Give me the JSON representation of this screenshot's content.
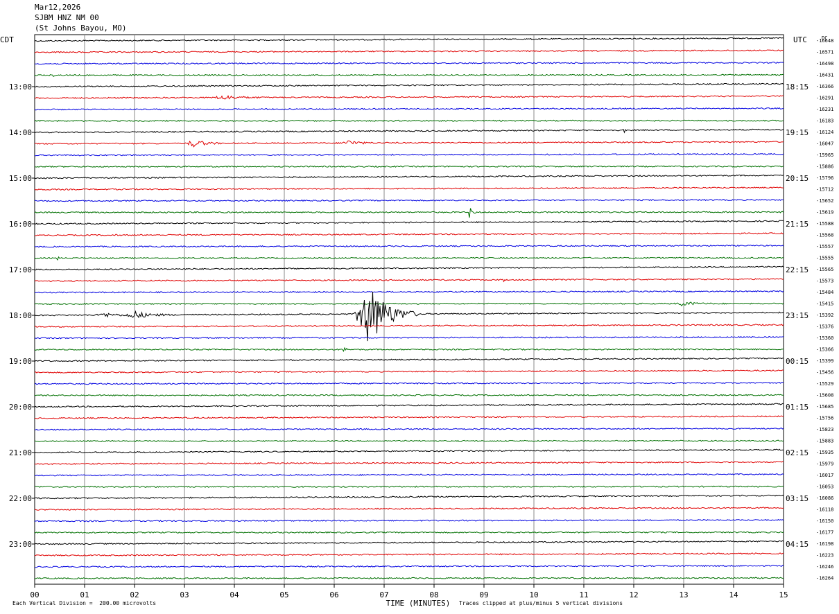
{
  "header": {
    "date": "Mar12,2026",
    "station": "SJBM HNZ NM 00",
    "location": "(St Johns Bayou, MO)"
  },
  "left_tz": "CDT",
  "right_tz": "UTC",
  "dc_label": "DC",
  "footer": {
    "scale_note": "Each Vertical Division =  200.00 microvolts",
    "clip_note": "Traces clipped at plus/minus 5 vertical divisions"
  },
  "colors": {
    "trace_cycle": [
      "#000000",
      "#e00000",
      "#0000e0",
      "#007000"
    ],
    "grid": "#888888"
  },
  "chart_data": {
    "type": "line",
    "title": "SJBM HNZ NM 00",
    "xlabel": "TIME (MINUTES)",
    "xlim": [
      0,
      15
    ],
    "x_ticks": [
      "00",
      "01",
      "02",
      "03",
      "04",
      "05",
      "06",
      "07",
      "08",
      "09",
      "10",
      "11",
      "12",
      "13",
      "14",
      "15"
    ],
    "left_hour_labels": [
      "13:00",
      "14:00",
      "15:00",
      "16:00",
      "17:00",
      "18:00",
      "19:00",
      "20:00",
      "21:00",
      "22:00",
      "23:00"
    ],
    "right_hour_labels": [
      "18:15",
      "19:15",
      "20:15",
      "21:15",
      "22:15",
      "23:15",
      "00:15",
      "01:15",
      "02:15",
      "03:15",
      "04:15"
    ],
    "dc_offsets": [
      "-16648",
      "-16571",
      "-16498",
      "-16431",
      "-16366",
      "-16291",
      "-16231",
      "-16183",
      "-16124",
      "-16047",
      "-15965",
      "-15886",
      "-15796",
      "-15712",
      "-15652",
      "-15619",
      "-15588",
      "-15568",
      "-15557",
      "-15555",
      "-15565",
      "-15573",
      "-15484",
      "-15415",
      "-15392",
      "-15376",
      "-15360",
      "-15366",
      "-15399",
      "-15456",
      "-15529",
      "-15608",
      "-15685",
      "-15756",
      "-15823",
      "-15883",
      "-15935",
      "-15979",
      "-16017",
      "-16053",
      "-16086",
      "-16118",
      "-16150",
      "-16177",
      "-16198",
      "-16223",
      "-16246",
      "-16264"
    ],
    "events": [
      {
        "trace": 24,
        "minute": 6.7,
        "amp": 45,
        "dur": 1.0,
        "desc": "earthquake"
      },
      {
        "trace": 24,
        "minute": 2.0,
        "amp": 5,
        "dur": 0.8
      },
      {
        "trace": 24,
        "minute": 1.4,
        "amp": 3,
        "dur": 0.6
      },
      {
        "trace": 9,
        "minute": 3.2,
        "amp": 5,
        "dur": 0.6
      },
      {
        "trace": 9,
        "minute": 6.3,
        "amp": 4,
        "dur": 0.5
      },
      {
        "trace": 15,
        "minute": 8.7,
        "amp": 9,
        "dur": 0.15
      },
      {
        "trace": 5,
        "minute": 3.8,
        "amp": 3,
        "dur": 0.8
      },
      {
        "trace": 17,
        "minute": 1.6,
        "amp": 5,
        "dur": 0.05
      },
      {
        "trace": 21,
        "minute": 9.4,
        "amp": 4,
        "dur": 0.05
      },
      {
        "trace": 8,
        "minute": 11.8,
        "amp": 6,
        "dur": 0.05
      },
      {
        "trace": 3,
        "minute": 0.35,
        "amp": 5,
        "dur": 0.05
      },
      {
        "trace": 19,
        "minute": 0.45,
        "amp": 5,
        "dur": 0.05
      },
      {
        "trace": 27,
        "minute": 6.2,
        "amp": 4,
        "dur": 0.1
      },
      {
        "trace": 23,
        "minute": 13.0,
        "amp": 3,
        "dur": 0.6
      }
    ]
  }
}
